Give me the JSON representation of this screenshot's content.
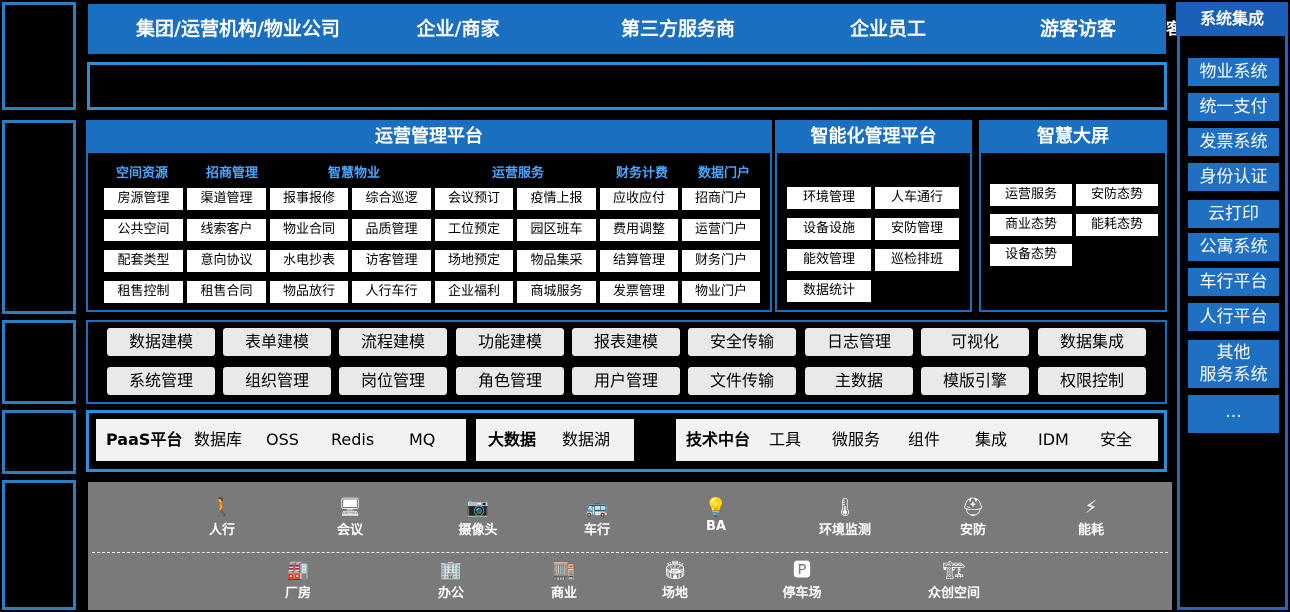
{
  "top_users": [
    "集团/运营机构/物业公司",
    "企业/商家",
    "第三方服务商",
    "企业员工",
    "游客访客"
  ],
  "top_cut_char": "客",
  "ops": {
    "title": "运营管理平台",
    "categories": [
      "空间资源",
      "招商管理",
      "智慧物业",
      "运营服务",
      "财务计费",
      "数据门户"
    ],
    "rows": [
      [
        "房源管理",
        "渠道管理",
        "报事报修",
        "综合巡逻",
        "会议预订",
        "疫情上报",
        "应收应付",
        "招商门户"
      ],
      [
        "公共空间",
        "线索客户",
        "物业合同",
        "品质管理",
        "工位预定",
        "园区班车",
        "费用调整",
        "运营门户"
      ],
      [
        "配套类型",
        "意向协议",
        "水电抄表",
        "访客管理",
        "场地预定",
        "物品集采",
        "结算管理",
        "财务门户"
      ],
      [
        "租售控制",
        "租售合同",
        "物品放行",
        "人行车行",
        "企业福利",
        "商城服务",
        "发票管理",
        "物业门户"
      ]
    ]
  },
  "smart_mgmt": {
    "title": "智能化管理平台",
    "items": [
      "环境管理",
      "人车通行",
      "设备设施",
      "安防管理",
      "能效管理",
      "巡检排班",
      "数据统计"
    ]
  },
  "big_screen": {
    "title": "智慧大屏",
    "items": [
      "运营服务",
      "安防态势",
      "商业态势",
      "能耗态势",
      "设备态势"
    ]
  },
  "modeling": {
    "row1": [
      "数据建模",
      "表单建模",
      "流程建模",
      "功能建模",
      "报表建模",
      "安全传输",
      "日志管理",
      "可视化",
      "数据集成"
    ],
    "row2": [
      "系统管理",
      "组织管理",
      "岗位管理",
      "角色管理",
      "用户管理",
      "文件传输",
      "主数据",
      "模版引擎",
      "权限控制"
    ]
  },
  "paas": {
    "title": "PaaS平台",
    "items": [
      "数据库",
      "OSS",
      "Redis",
      "MQ"
    ]
  },
  "bigdata": {
    "title": "大数据",
    "items": [
      "数据湖"
    ]
  },
  "tech": {
    "title": "技术中台",
    "items": [
      "工具",
      "微服务",
      "组件",
      "集成",
      "IDM",
      "安全"
    ]
  },
  "devices": [
    {
      "label": "人行",
      "icon": "walking-person-icon"
    },
    {
      "label": "会议",
      "icon": "monitor-icon"
    },
    {
      "label": "摄像头",
      "icon": "camera-icon"
    },
    {
      "label": "车行",
      "icon": "bus-icon"
    },
    {
      "label": "BA",
      "icon": "bulb-icon"
    },
    {
      "label": "环境监测",
      "icon": "thermometer-icon"
    },
    {
      "label": "安防",
      "icon": "security-icon"
    },
    {
      "label": "能耗",
      "icon": "power-tower-icon"
    }
  ],
  "spaces": [
    {
      "label": "厂房",
      "icon": "factory-icon"
    },
    {
      "label": "办公",
      "icon": "office-icon"
    },
    {
      "label": "商业",
      "icon": "commerce-icon"
    },
    {
      "label": "场地",
      "icon": "venue-icon"
    },
    {
      "label": "停车场",
      "icon": "parking-icon"
    },
    {
      "label": "众创空间",
      "icon": "crane-icon"
    }
  ],
  "right": {
    "title": "系统集成",
    "items": [
      "物业系统",
      "统一支付",
      "发票系统",
      "身份认证",
      "云打印",
      "公寓系统",
      "车行平台",
      "人行平台",
      "其他服务系统",
      "..."
    ]
  },
  "colors": {
    "accent": "#1a6fc1",
    "border": "#2a7fc4",
    "category": "#4aa4ff",
    "device_bg": "#7a7a7a"
  }
}
